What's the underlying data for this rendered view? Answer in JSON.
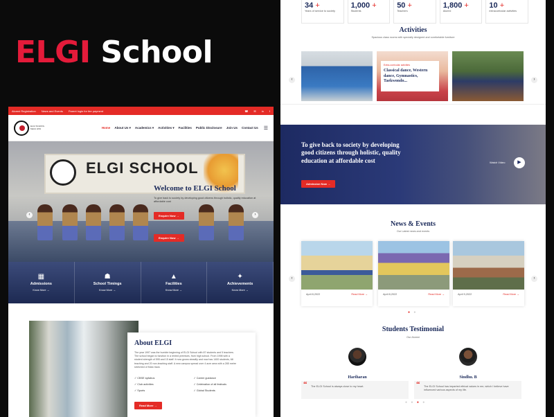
{
  "brand": {
    "part1": "ELGI",
    "part2": "School"
  },
  "left": {
    "topbar": {
      "links": [
        "Alumni Registration",
        "News and Events",
        "Parent login for fee payment"
      ],
      "icons": [
        "phone-icon",
        "mail-icon",
        "linkedin-icon",
        "facebook-icon"
      ]
    },
    "logo_text": "ELGI SCHOOL Matric HSS",
    "menu": [
      "Home",
      "About Us ▾",
      "Academics ▾",
      "Activities ▾",
      "Facilities",
      "Public Disclosure",
      "Join Us",
      "Contact Us"
    ],
    "hero": {
      "banner": "ELGI SCHOOL",
      "title": "Welcome to ELGI School",
      "subtitle": "To give back to society by developing good citizens through holistic, quality education at affordable cost",
      "btn1": "Enquire Now →",
      "btn2": "Enquire Now →"
    },
    "features": [
      {
        "title": "Admissions",
        "link": "Know More →"
      },
      {
        "title": "School Timings",
        "link": "Know More →"
      },
      {
        "title": "Facilities",
        "link": "Know More →"
      },
      {
        "title": "Achievements",
        "link": "Know More →"
      }
    ],
    "about": {
      "title": "About ELGI",
      "text": "The year 1997 was the humble beginning of ELGI School with 87 students and 5 teachers. The school began to function in a rented premises, from high school. From 1998 with a student strength of 595 and 15 staff. It now grows steadily and now has 1400 students, 68 teaching and 20 non-teaching staff. A new campus spread over 4 acre area with a 285 metre stretched of Mato track.",
      "list": [
        "CBSE syllabus",
        "Career guidance",
        "Club activities",
        "Celebration of all festivals",
        "Sports",
        "Global Students"
      ],
      "button": "Read More →"
    }
  },
  "right": {
    "stats": [
      {
        "num": "34",
        "plus": "+",
        "label": "Years of service to society"
      },
      {
        "num": "1,000",
        "plus": "+",
        "label": "Students"
      },
      {
        "num": "50",
        "plus": "+",
        "label": "Teachers"
      },
      {
        "num": "1,800",
        "plus": "+",
        "label": "Alumni"
      },
      {
        "num": "10",
        "plus": "+",
        "label": "extracurricular activities"
      }
    ],
    "activities": {
      "title": "Activities",
      "subtitle": "Spacious class rooms with specially designed and comfortable furniture",
      "card_kicker": "Extra-curricular activities",
      "card_title": "Classical dance, Western dance, Gymnastics, Taekwondo..."
    },
    "mission": {
      "quote": "To give back to society by developing good citizens through holistic, quality education at affordable cost",
      "watch": "Watch Video",
      "button": "Admission Now →"
    },
    "news": {
      "title": "News & Events",
      "subtitle": "Our Latest news and events",
      "items": [
        {
          "date": "April 8,2022",
          "link": "Read More →"
        },
        {
          "date": "April 8,2022",
          "link": "Read More →"
        },
        {
          "date": "April 9,2022",
          "link": "Read More →"
        }
      ]
    },
    "testimonials": {
      "title": "Students Testimonial",
      "subtitle": "Our Alumni",
      "items": [
        {
          "name": "Hariharan",
          "quote": "The ELGI School is always close to my heart."
        },
        {
          "name": "Sindhu. B",
          "quote": "The ELGI School has imparted ethical values in me, which I believe have influenced various aspects of my life."
        }
      ]
    }
  }
}
